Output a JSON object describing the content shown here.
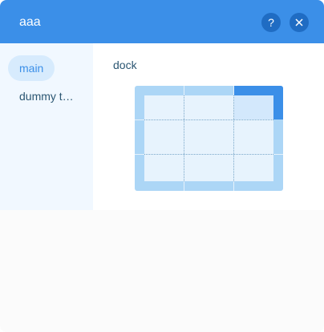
{
  "panel": {
    "title": "aaa",
    "help_icon": "question-icon",
    "close_icon": "close-icon",
    "colors": {
      "header": "#3b8fe8",
      "header_button": "#1f6cc3",
      "dock_selected": "#3b8fe8",
      "dock_frame": "#acd6f6"
    }
  },
  "sidebar": {
    "tabs": [
      {
        "label": "main",
        "selected": true
      },
      {
        "label": "dummy t…",
        "selected": false
      }
    ]
  },
  "dock": {
    "label": "dock",
    "rows": 3,
    "columns": 3,
    "selected_position": "top-right"
  }
}
